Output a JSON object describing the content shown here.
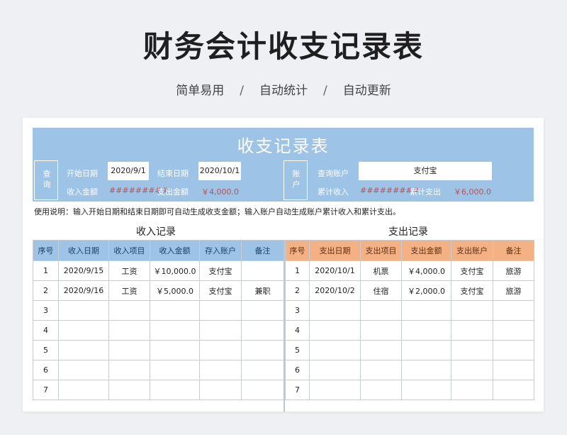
{
  "page": {
    "title": "财务会计收支记录表",
    "subtitle_items": [
      "简单易用",
      "自动统计",
      "自动更新"
    ],
    "subtitle_sep": "/"
  },
  "banner": {
    "title": "收支记录表",
    "query_label": "查询",
    "start_date_label": "开始日期",
    "start_date": "2020/9/1",
    "end_date_label": "结束日期",
    "end_date": "2020/10/1",
    "income_amount_label": "收入金额",
    "income_amount": "#########",
    "expense_amount_label": "支出金额",
    "expense_amount": "￥4,000.0",
    "account_label": "账户",
    "query_account_label": "查询账户",
    "query_account": "支付宝",
    "total_income_label": "累计收入",
    "total_income": "#########",
    "total_expense_label": "累计支出",
    "total_expense": "￥6,000.0"
  },
  "note": "使用说明：输入开始日期和结束日期即可自动生成收支金额；输入账户自动生成账户累计收入和累计支出。",
  "income": {
    "title": "收入记录",
    "headers": [
      "序号",
      "收入日期",
      "收入项目",
      "收入金额",
      "存入账户",
      "备注"
    ],
    "rows": [
      [
        "1",
        "2020/9/15",
        "工资",
        "￥10,000.0",
        "支付宝",
        ""
      ],
      [
        "2",
        "2020/9/16",
        "工资",
        "￥5,000.0",
        "支付宝",
        "兼职"
      ],
      [
        "3",
        "",
        "",
        "",
        "",
        ""
      ],
      [
        "4",
        "",
        "",
        "",
        "",
        ""
      ],
      [
        "5",
        "",
        "",
        "",
        "",
        ""
      ],
      [
        "6",
        "",
        "",
        "",
        "",
        ""
      ],
      [
        "7",
        "",
        "",
        "",
        "",
        ""
      ]
    ]
  },
  "expense": {
    "title": "支出记录",
    "headers": [
      "序号",
      "支出日期",
      "支出项目",
      "支出金额",
      "支出账户",
      "备注"
    ],
    "rows": [
      [
        "1",
        "2020/10/1",
        "机票",
        "￥4,000.0",
        "支付宝",
        "旅游"
      ],
      [
        "2",
        "2020/10/2",
        "住宿",
        "￥2,000.0",
        "支付宝",
        "旅游"
      ],
      [
        "3",
        "",
        "",
        "",
        "",
        ""
      ],
      [
        "4",
        "",
        "",
        "",
        "",
        ""
      ],
      [
        "5",
        "",
        "",
        "",
        "",
        ""
      ],
      [
        "6",
        "",
        "",
        "",
        "",
        ""
      ],
      [
        "7",
        "",
        "",
        "",
        "",
        ""
      ]
    ]
  },
  "colors": {
    "income_header": "#9dc3e6",
    "expense_header": "#f4b183",
    "amount_text": "#c0504d"
  }
}
